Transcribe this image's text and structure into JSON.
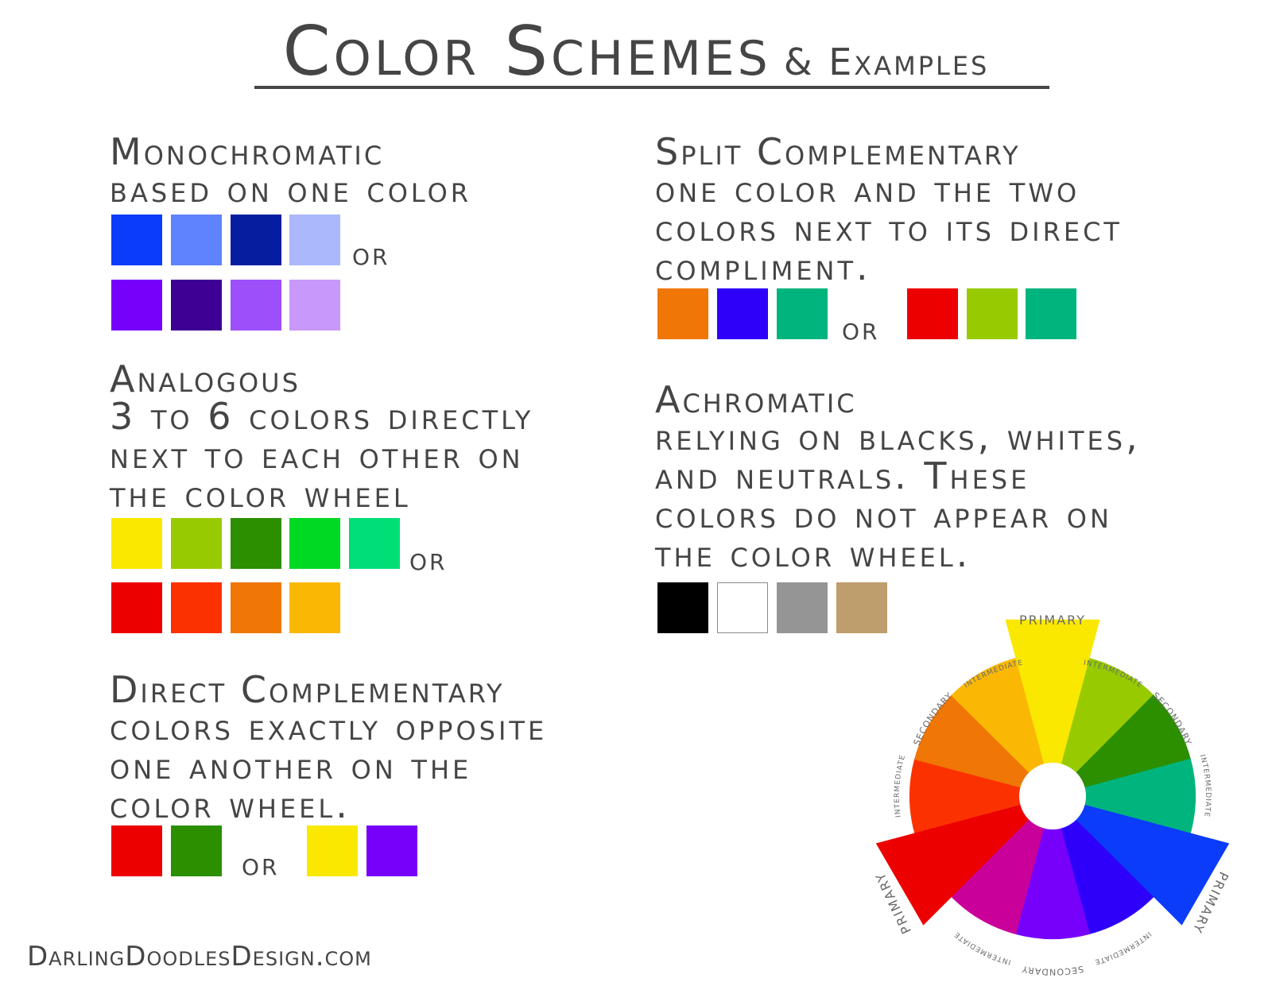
{
  "title": {
    "main": "Color Schemes",
    "sub": "& Examples"
  },
  "sections": [
    {
      "id": "monochromatic",
      "heading": "Monochromatic",
      "lines": [
        "based on one color"
      ],
      "rows": [
        [
          "#0a3cfa",
          "#5f83fc",
          "#051ea0",
          "#abb8fc"
        ],
        [
          "#7600fa",
          "#3e0094",
          "#9d4ffa",
          "#c898fa"
        ]
      ],
      "or": "or"
    },
    {
      "id": "analogous",
      "heading": "Analogous",
      "lines": [
        "3 to 6 colors directly",
        "next to each other on",
        "the color wheel"
      ],
      "rows": [
        [
          "#fae800",
          "#97cb00",
          "#2b8f00",
          "#00d924",
          "#00de78"
        ],
        [
          "#ed0000",
          "#fb3200",
          "#f07605",
          "#fab805"
        ]
      ],
      "or": "or"
    },
    {
      "id": "direct",
      "heading": "Direct Complementary",
      "lines": [
        "colors exactly opposite",
        "one another on the",
        "color wheel."
      ],
      "rows": [
        [
          "#ed0000",
          "#2b8f00",
          "#fae800",
          "#7600fa"
        ]
      ],
      "or": "or"
    },
    {
      "id": "split",
      "heading": "Split Complementary",
      "lines": [
        "one color and the two",
        "colors next to its direct",
        "compliment."
      ],
      "rows": [
        [
          "#f07605",
          "#2e00fa",
          "#00b57d",
          "#ed0000",
          "#97cb00",
          "#00b57d"
        ]
      ],
      "or": "or"
    },
    {
      "id": "achromatic",
      "heading": "Achromatic",
      "lines": [
        "relying on blacks, whites,",
        "and neutrals.  These",
        "colors do not appear on",
        "the color wheel."
      ],
      "rows": [
        [
          "#000000",
          "#ffffff",
          "#959595",
          "#bd9e6c"
        ]
      ]
    }
  ],
  "wheel": {
    "center": "#ffffff",
    "colors": {
      "yellow": "#fae800",
      "yellow_green": "#97cb00",
      "green": "#2b8f00",
      "blue_green": "#00b57d",
      "blue": "#0a3cfa",
      "blue_violet": "#2e00fa",
      "violet": "#7600fa",
      "red_violet": "#c9009a",
      "red": "#ed0000",
      "red_orange": "#fb3200",
      "orange": "#f07605",
      "yellow_orange": "#fab805"
    },
    "labels": {
      "primary_top": "PRIMARY",
      "primary_left": "PRIMARY",
      "primary_right": "PRIMARY",
      "intermediate_1": "INTERMEDIATE",
      "secondary_1": "SECONDARY",
      "intermediate_2": "INTERMEDIATE",
      "intermediate_3": "INTERMEDIATE",
      "secondary_2": "SECONDARY",
      "intermediate_4": "INTERMEDIATE",
      "intermediate_5": "INTERMEDIATE",
      "secondary_3": "SECONDARY",
      "intermediate_6": "INTERMEDIATE"
    }
  },
  "footer": "DarlingDoodlesDesign.com"
}
